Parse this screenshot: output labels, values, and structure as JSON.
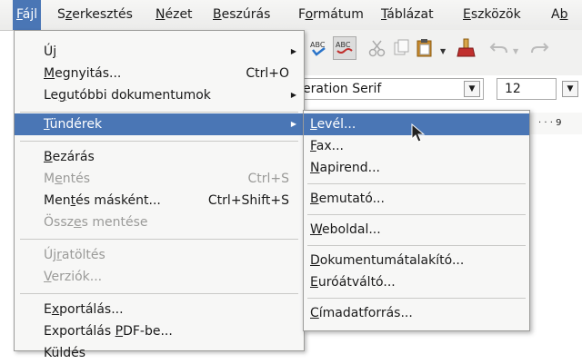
{
  "menubar": {
    "items": [
      {
        "u": "F",
        "rest": "ájl"
      },
      {
        "pre": "S",
        "u": "z",
        "rest": "erkesztés"
      },
      {
        "u": "N",
        "rest": "ézet"
      },
      {
        "u": "B",
        "rest": "eszúrás"
      },
      {
        "pre": "F",
        "u": "o",
        "rest": "rmátum"
      },
      {
        "u": "T",
        "rest": "áblázat"
      },
      {
        "u": "E",
        "rest": "szközök"
      },
      {
        "pre": "A",
        "u": "b",
        "rest": ""
      }
    ]
  },
  "toolbar": {
    "font_name": "eration Serif",
    "font_size": "12",
    "ruler_text": "· · · 9"
  },
  "file_menu": {
    "new": {
      "pre": "Ú",
      "u": "j",
      "rest": ""
    },
    "open": {
      "u": "M",
      "rest": "egnyitás...",
      "shortcut": "Ctrl+O"
    },
    "recent": {
      "pre": "Le",
      "u": "g",
      "rest": "utóbbi dokumentumok"
    },
    "wizards": {
      "u": "T",
      "rest": "ündérek"
    },
    "close": {
      "u": "B",
      "rest": "ezárás"
    },
    "save": {
      "pre": "M",
      "u": "e",
      "rest": "ntés",
      "shortcut": "Ctrl+S"
    },
    "save_as": {
      "pre": "Men",
      "u": "t",
      "rest": "és másként...",
      "shortcut": "Ctrl+Shift+S"
    },
    "save_all": {
      "pre": "Össz",
      "u": "e",
      "rest": "s mentése"
    },
    "reload": {
      "pre": "Új",
      "u": "r",
      "rest": "atöltés"
    },
    "versions": {
      "u": "V",
      "rest": "erziók..."
    },
    "export": {
      "pre": "E",
      "u": "x",
      "rest": "portálás..."
    },
    "export_pdf": {
      "pre": "Exportálás ",
      "u": "P",
      "rest": "DF-be..."
    },
    "send": {
      "pre": "Küldés",
      "u": "",
      "rest": ""
    }
  },
  "wizards_submenu": {
    "letter": {
      "u": "L",
      "rest": "evél..."
    },
    "fax": {
      "u": "F",
      "rest": "ax..."
    },
    "agenda": {
      "u": "N",
      "rest": "apirend..."
    },
    "presentation": {
      "u": "B",
      "rest": "emutató..."
    },
    "webpage": {
      "u": "W",
      "rest": "eboldal..."
    },
    "doc_converter": {
      "u": "D",
      "rest": "okumentumátalakító..."
    },
    "euro_converter": {
      "u": "E",
      "rest": "uróátváltó..."
    },
    "address_source": {
      "u": "C",
      "rest": "ímadatforrás..."
    }
  }
}
